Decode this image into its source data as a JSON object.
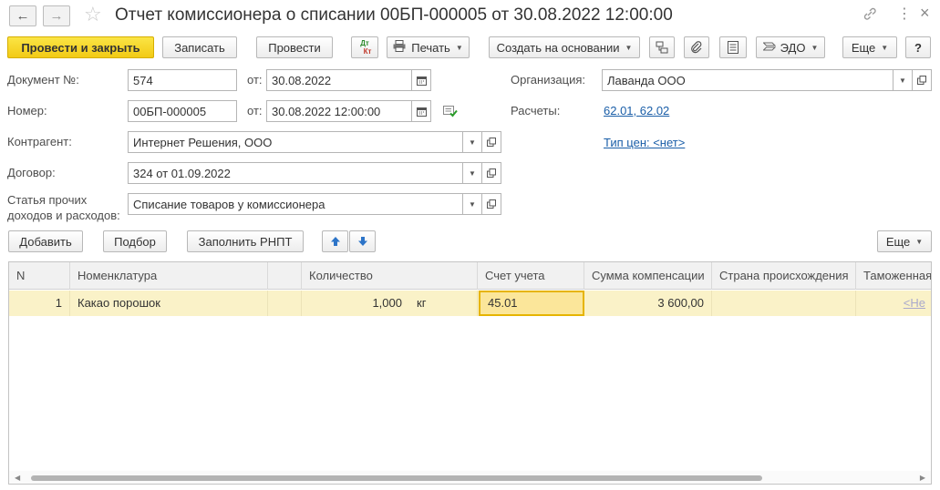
{
  "header": {
    "title": "Отчет комиссионера о списании 00БП-000005 от 30.08.2022 12:00:00",
    "back_icon": "←",
    "forward_icon": "→",
    "star_icon": "☆",
    "link_icon": "🔗",
    "menu_icon": "⋮",
    "close_icon": "×"
  },
  "toolbar": {
    "post_close": "Провести и закрыть",
    "save": "Записать",
    "post": "Провести",
    "dtkt_top": "Дт",
    "dtkt_bottom": "Кт",
    "print": "Печать",
    "create_based": "Создать на основании",
    "edo": "ЭДО",
    "more": "Еще",
    "help": "?"
  },
  "form": {
    "doc_number_label": "Документ №:",
    "doc_number": "574",
    "from_label_1": "от:",
    "doc_date": "30.08.2022",
    "number_label": "Номер:",
    "number": "00БП-000005",
    "from_label_2": "от:",
    "number_date": "30.08.2022 12:00:00",
    "org_label": "Организация:",
    "org": "Лаванда ООО",
    "settlements_label": "Расчеты:",
    "settlements": "62.01, 62.02",
    "price_type": "Тип цен: <нет>",
    "counterparty_label": "Контрагент:",
    "counterparty": "Интернет Решения, ООО",
    "contract_label": "Договор:",
    "contract": "324 от 01.09.2022",
    "other_income_label_1": "Статья прочих",
    "other_income_label_2": "доходов и расходов:",
    "other_income": "Списание товаров у комиссионера"
  },
  "table_toolbar": {
    "add": "Добавить",
    "selection": "Подбор",
    "fill": "Заполнить РНПТ",
    "more": "Еще"
  },
  "table": {
    "columns": [
      "N",
      "Номенклатура",
      "",
      "Количество",
      "Счет учета",
      "Сумма компенсации",
      "Страна происхождения",
      "Таможенная"
    ],
    "rows": [
      {
        "n": "1",
        "item": "Какао порошок",
        "qty": "1,000",
        "unit": "кг",
        "account": "45.01",
        "amount": "3 600,00",
        "country": "",
        "customs": "<Не"
      }
    ]
  },
  "colors": {
    "accent_yellow": "#f2ca15",
    "link_blue": "#1a5ea8",
    "row_selected": "#faf2c8"
  }
}
